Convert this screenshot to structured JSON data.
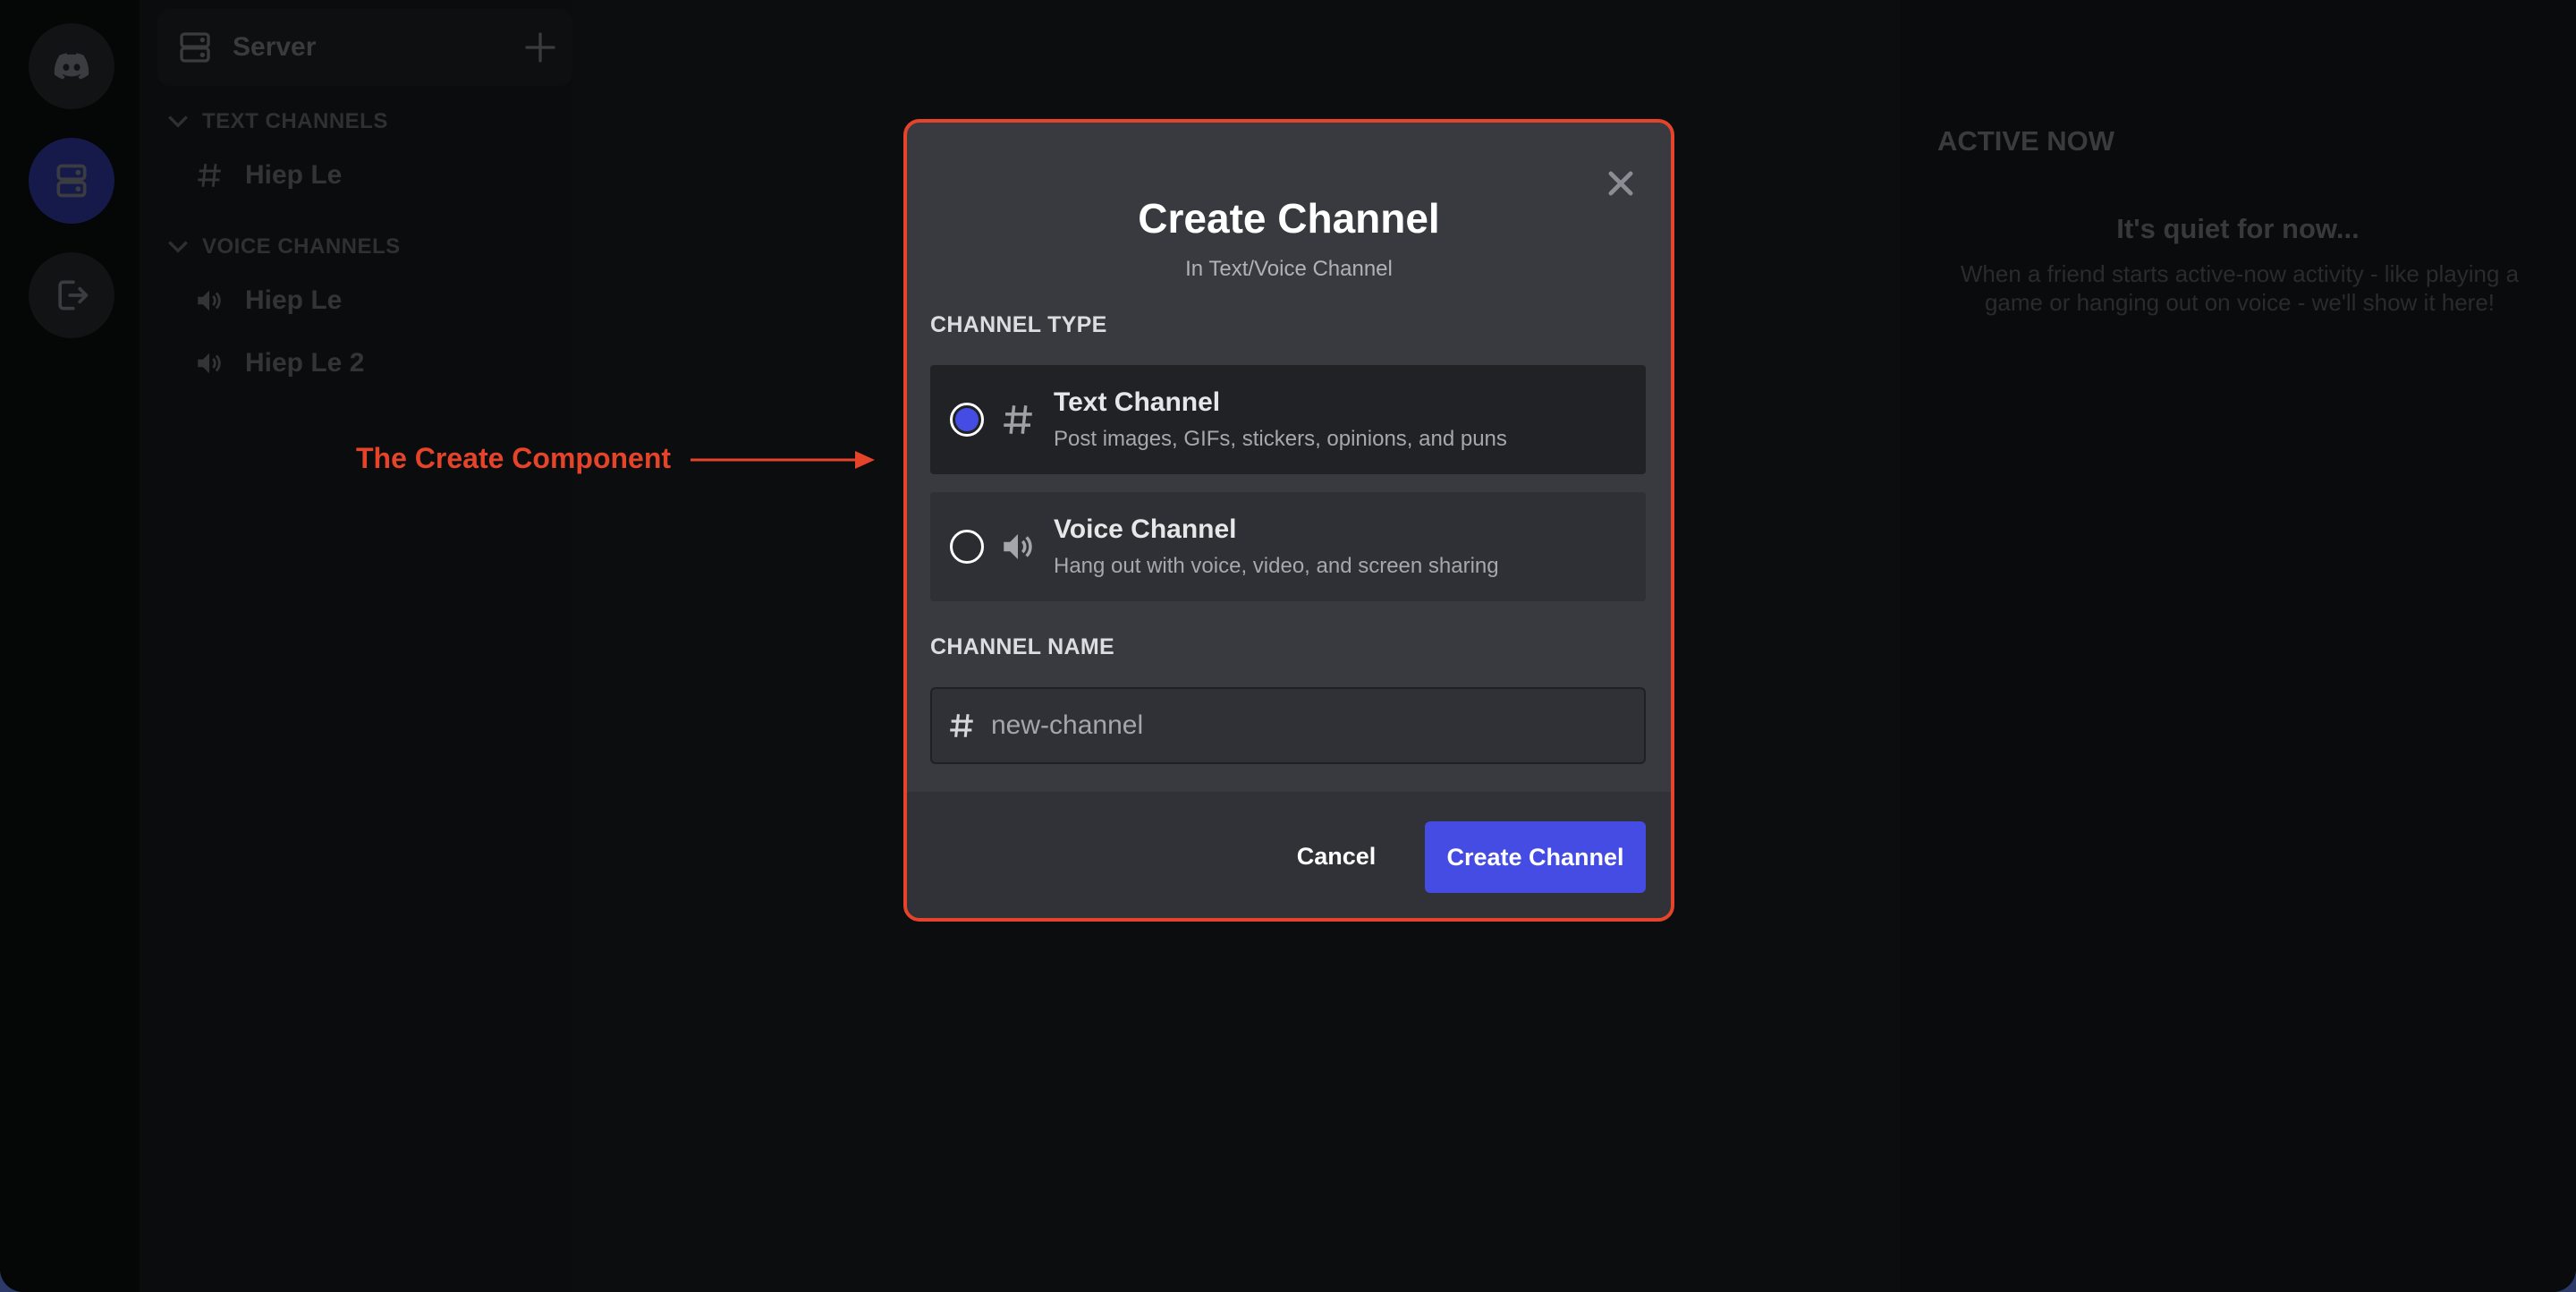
{
  "rail": {
    "items": [
      {
        "name": "discord-home",
        "icon": "discord-logo-icon"
      },
      {
        "name": "server",
        "icon": "server-icon",
        "active": true
      },
      {
        "name": "logout",
        "icon": "logout-icon"
      }
    ]
  },
  "sidebar": {
    "server_title": "Server",
    "categories": [
      {
        "label": "TEXT CHANNELS",
        "channels": [
          {
            "name": "Hiep Le",
            "type": "text"
          }
        ]
      },
      {
        "label": "VOICE CHANNELS",
        "channels": [
          {
            "name": "Hiep Le",
            "type": "voice"
          },
          {
            "name": "Hiep Le 2",
            "type": "voice"
          }
        ]
      }
    ]
  },
  "active_now": {
    "title": "ACTIVE NOW",
    "empty_title": "It's quiet for now...",
    "empty_desc": "When a friend starts active-now activity - like playing a game or hanging out on voice - we'll show it here!"
  },
  "annotation": {
    "label": "The Create Component",
    "color": "#e5432a"
  },
  "modal": {
    "title": "Create Channel",
    "subtitle": "In Text/Voice Channel",
    "channel_type_label": "CHANNEL TYPE",
    "options": [
      {
        "name": "Text Channel",
        "desc": "Post images, GIFs, stickers, opinions, and puns",
        "icon": "hash-icon",
        "selected": true
      },
      {
        "name": "Voice Channel",
        "desc": "Hang out with voice, video, and screen sharing",
        "icon": "speaker-icon",
        "selected": false
      }
    ],
    "channel_name_label": "CHANNEL NAME",
    "channel_name_placeholder": "new-channel",
    "channel_name_value": "",
    "cancel_label": "Cancel",
    "create_label": "Create Channel",
    "accent_color": "#444ce4"
  }
}
